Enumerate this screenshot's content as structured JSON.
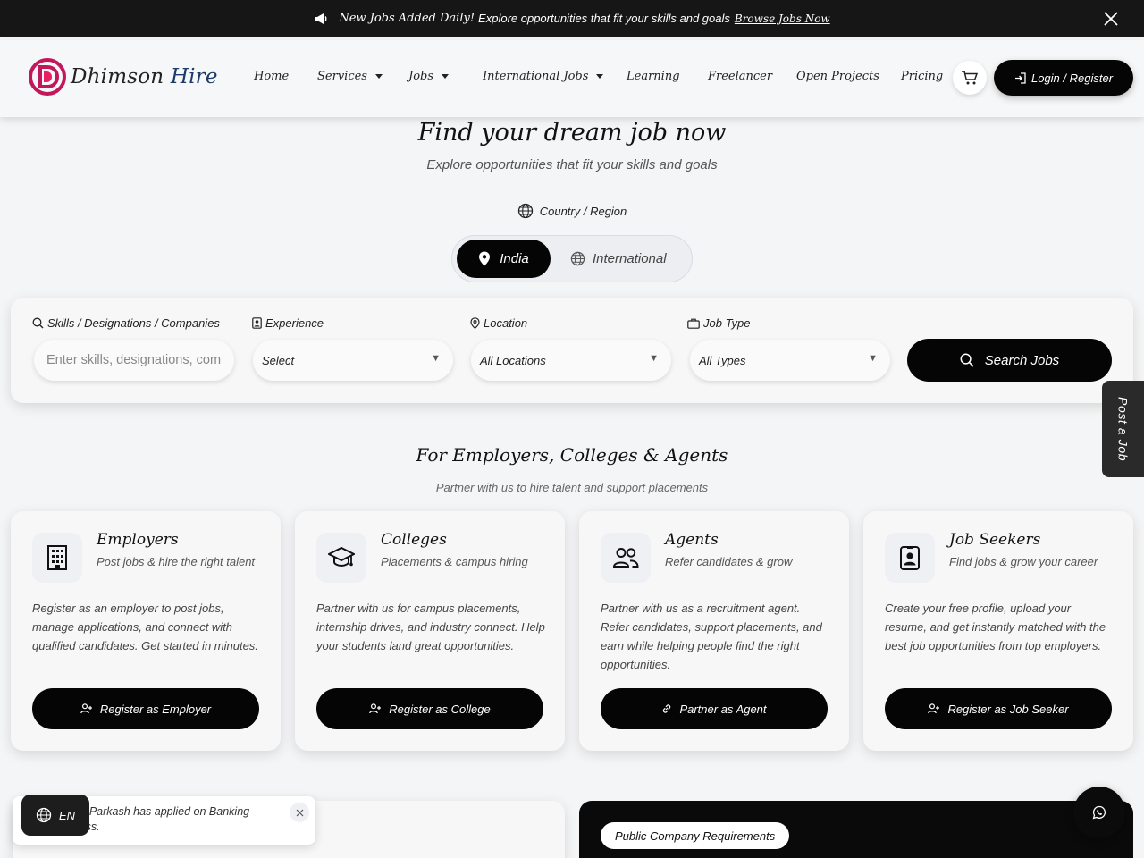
{
  "announcement": {
    "highlight": "New Jobs Added Daily!",
    "text": "Explore opportunities that fit your skills and goals",
    "link": "Browse Jobs Now"
  },
  "header": {
    "logo_part1": "Dhimson",
    "logo_part2": "Hire",
    "nav": [
      {
        "label": "Home"
      },
      {
        "label": "Services"
      },
      {
        "label": "Jobs"
      },
      {
        "label": "International Jobs"
      },
      {
        "label": "Learning"
      },
      {
        "label": "Freelancer"
      },
      {
        "label": "Open Projects"
      },
      {
        "label": "Pricing"
      }
    ],
    "login_label": "Login / Register"
  },
  "hero": {
    "title": "Find your dream job now",
    "subtitle": "Explore opportunities that fit your skills and goals",
    "region_label": "Country / Region",
    "toggle_india": "India",
    "toggle_international": "International"
  },
  "search": {
    "skills_label": "Skills / Designations / Companies",
    "skills_placeholder": "Enter skills, designations, companies",
    "experience_label": "Experience",
    "experience_value": "Select",
    "location_label": "Location",
    "location_value": "All Locations",
    "jobtype_label": "Job Type",
    "jobtype_value": "All Types",
    "button": "Search Jobs"
  },
  "side_tab": "Post a Job",
  "section": {
    "title": "For Employers, Colleges & Agents",
    "subtitle": "Partner with us to hire talent and support placements",
    "cards": [
      {
        "title": "Employers",
        "tagline": "Post jobs & hire the right talent",
        "description": "Register as an employer to post jobs, manage applications, and connect with qualified candidates. Get started in minutes.",
        "button": "Register as Employer"
      },
      {
        "title": "Colleges",
        "tagline": "Placements & campus hiring",
        "description": "Partner with us for campus placements, internship drives, and industry connect. Help your students land great opportunities.",
        "button": "Register as College"
      },
      {
        "title": "Agents",
        "tagline": "Refer candidates & grow",
        "description": "Partner with us as a recruitment agent. Refer candidates, support placements, and earn while helping people find the right opportunities.",
        "button": "Partner as Agent"
      },
      {
        "title": "Job Seekers",
        "tagline": "Find jobs & grow your career",
        "description": "Create your free profile, upload your resume, and get instantly matched with the best job opportunities from top employers.",
        "button": "Register as Job Seeker"
      }
    ]
  },
  "bottom": {
    "pill": "Public Company Requirements"
  },
  "toast": {
    "text": "Harka Parkash has applied on Banking Process."
  },
  "language": "EN"
}
